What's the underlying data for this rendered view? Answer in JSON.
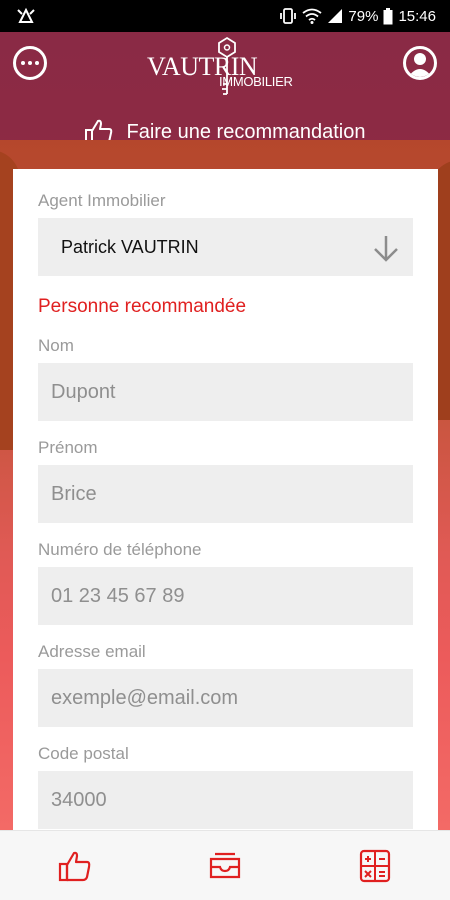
{
  "status_bar": {
    "battery": "79%",
    "time": "15:46",
    "icons": [
      "notification-icon",
      "vibrate-icon",
      "wifi-icon",
      "signal-icon",
      "battery-icon"
    ]
  },
  "header": {
    "logo_main": "VAUTRIN",
    "logo_sub": "IMMOBILIER",
    "title": "Faire une recommandation",
    "icons": [
      "more-icon",
      "profile-icon",
      "thumbs-up-icon"
    ]
  },
  "form": {
    "agent": {
      "label": "Agent Immobilier",
      "value": "Patrick VAUTRIN"
    },
    "section_title": "Personne recommandée",
    "fields": [
      {
        "label": "Nom",
        "placeholder": "Dupont"
      },
      {
        "label": "Prénom",
        "placeholder": "Brice"
      },
      {
        "label": "Numéro de téléphone",
        "placeholder": "01 23 45 67 89"
      },
      {
        "label": "Adresse email",
        "placeholder": "exemple@email.com"
      },
      {
        "label": "Code postal",
        "placeholder": "34000"
      }
    ]
  },
  "bottom_nav": {
    "tabs": [
      "thumbs-up-icon",
      "inbox-icon",
      "calculator-icon"
    ]
  },
  "colors": {
    "header_bg": "#8a2a45",
    "accent": "#e02020",
    "field_bg": "#eeeeee",
    "label": "#9a9a9a"
  }
}
